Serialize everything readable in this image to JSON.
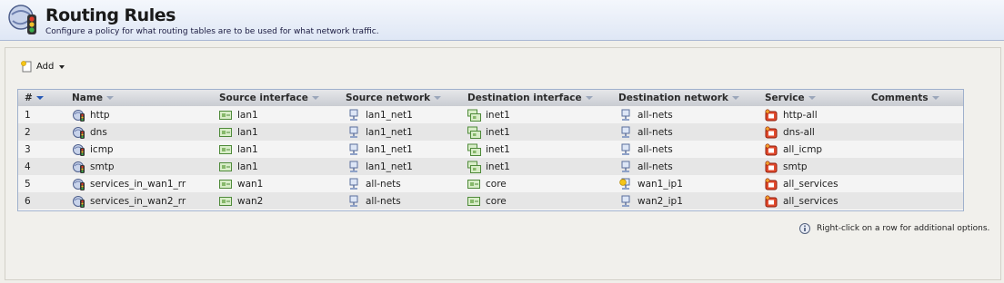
{
  "header": {
    "title": "Routing Rules",
    "description": "Configure a policy for what routing tables are to be used for what network traffic."
  },
  "toolbar": {
    "add_label": "Add"
  },
  "table": {
    "columns": [
      "#",
      "Name",
      "Source interface",
      "Source network",
      "Destination interface",
      "Destination network",
      "Service",
      "Comments"
    ],
    "rows": [
      {
        "num": "1",
        "name": "http",
        "src_if": "lan1",
        "src_net": "lan1_net1",
        "dst_if": "inet1",
        "dst_if_icon": "interface-group-icon",
        "dst_net": "all-nets",
        "dst_net_icon": "network-object-icon",
        "service": "http-all",
        "comments": ""
      },
      {
        "num": "2",
        "name": "dns",
        "src_if": "lan1",
        "src_net": "lan1_net1",
        "dst_if": "inet1",
        "dst_if_icon": "interface-group-icon",
        "dst_net": "all-nets",
        "dst_net_icon": "network-object-icon",
        "service": "dns-all",
        "comments": ""
      },
      {
        "num": "3",
        "name": "icmp",
        "src_if": "lan1",
        "src_net": "lan1_net1",
        "dst_if": "inet1",
        "dst_if_icon": "interface-group-icon",
        "dst_net": "all-nets",
        "dst_net_icon": "network-object-icon",
        "service": "all_icmp",
        "comments": ""
      },
      {
        "num": "4",
        "name": "smtp",
        "src_if": "lan1",
        "src_net": "lan1_net1",
        "dst_if": "inet1",
        "dst_if_icon": "interface-group-icon",
        "dst_net": "all-nets",
        "dst_net_icon": "network-object-icon",
        "service": "smtp",
        "comments": ""
      },
      {
        "num": "5",
        "name": "services_in_wan1_rr",
        "src_if": "wan1",
        "src_net": "all-nets",
        "dst_if": "core",
        "dst_if_icon": "interface-icon",
        "dst_net": "wan1_ip1",
        "dst_net_icon": "network-object-locked-icon",
        "service": "all_services",
        "comments": ""
      },
      {
        "num": "6",
        "name": "services_in_wan2_rr",
        "src_if": "wan2",
        "src_net": "all-nets",
        "dst_if": "core",
        "dst_if_icon": "interface-icon",
        "dst_net": "wan2_ip1",
        "dst_net_icon": "network-object-icon",
        "service": "all_services",
        "comments": ""
      }
    ]
  },
  "hint": {
    "text": "Right-click on a row for additional options."
  },
  "colors": {
    "header_bg": "#dfe7f5",
    "grid_border": "#9fb0cc",
    "row_odd": "#f4f4f4",
    "row_even": "#e6e6e6",
    "sort_active": "#2557b5"
  }
}
